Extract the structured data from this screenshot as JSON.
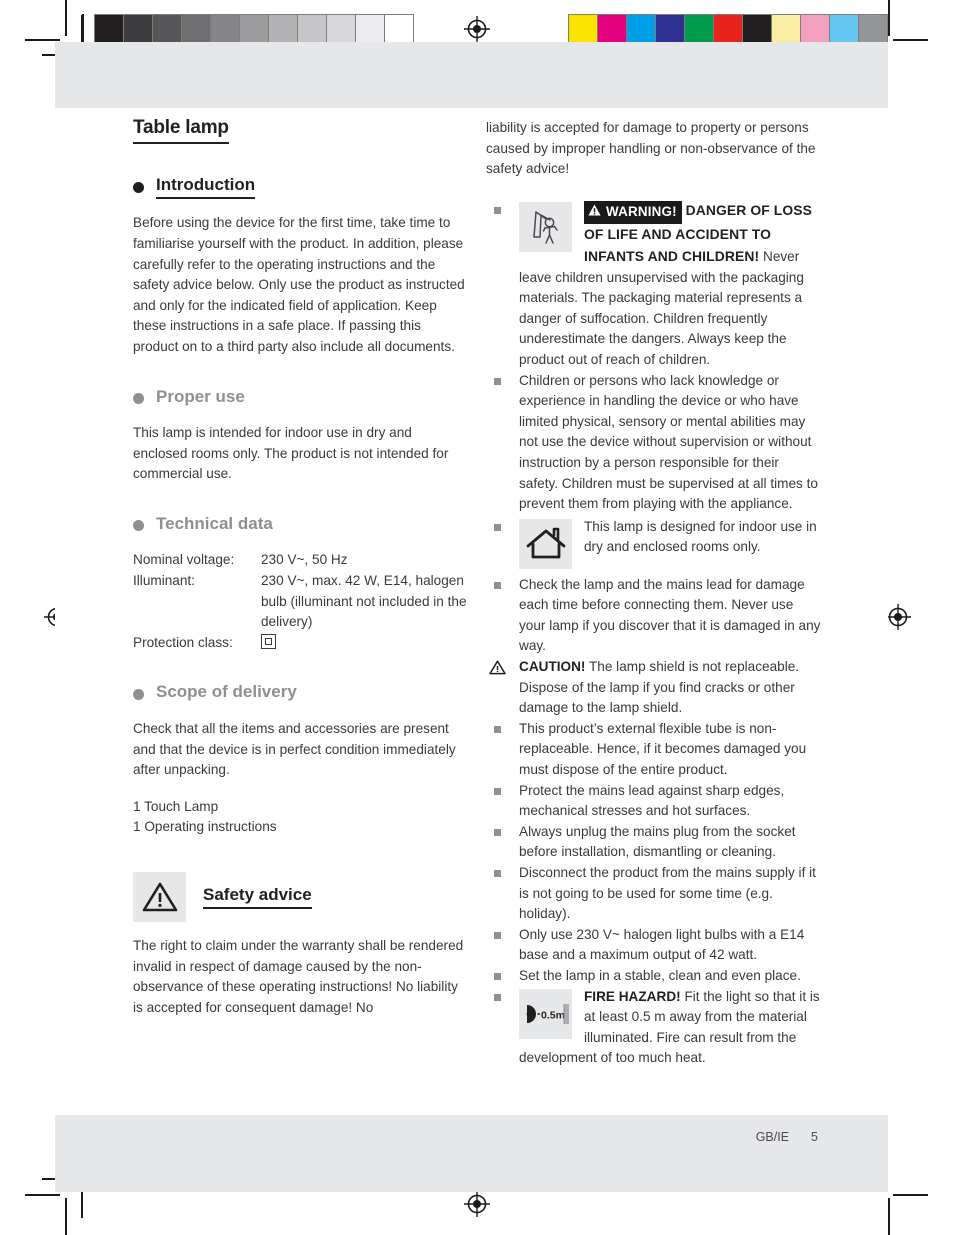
{
  "document": {
    "title": "Table lamp",
    "footer": {
      "locale": "GB/IE",
      "page": "5"
    }
  },
  "calibration": {
    "grayscale_bar": [
      "#231f20",
      "#3c3c3e",
      "#565658",
      "#6e6e70",
      "#868688",
      "#9c9c9e",
      "#b2b2b4",
      "#c6c6c8",
      "#d7d7d9",
      "#ececee",
      "#ffffff"
    ],
    "color_bar": [
      "#fbe500",
      "#e4007f",
      "#00a0e9",
      "#2e3192",
      "#009b4d",
      "#e8221d",
      "#231f20",
      "#faeca0",
      "#f4a0c0",
      "#63c7ef",
      "#939598"
    ]
  },
  "left_column": {
    "sections": [
      {
        "id": "introduction",
        "heading": "Introduction",
        "heading_style": "black",
        "paragraphs": [
          "Before using the device for the first time, take time to familiarise yourself with the product. In addition, please carefully refer to the operating instructions and the safety advice below. Only use the product as instructed and only for the indicated field of application. Keep these instructions in a safe place. If passing this product on to a third party also include all documents."
        ]
      },
      {
        "id": "proper-use",
        "heading": "Proper use",
        "heading_style": "grey",
        "paragraphs": [
          "This lamp is intended for indoor use in dry and enclosed rooms only. The product is not intended for commercial use."
        ]
      },
      {
        "id": "technical-data",
        "heading": "Technical data",
        "heading_style": "grey",
        "table": [
          {
            "key": "Nominal voltage:",
            "value": "230 V~, 50 Hz"
          },
          {
            "key": "Illuminant:",
            "value": "230 V~, max. 42 W, E14, halogen bulb (illuminant not included in the delivery)"
          },
          {
            "key": "Protection class:",
            "value": "",
            "icon": "protection-class-2-icon"
          }
        ]
      },
      {
        "id": "scope-of-delivery",
        "heading": "Scope of delivery",
        "heading_style": "grey",
        "paragraphs": [
          "Check that all the items and accessories are present and that the device is in perfect condition immediately after unpacking."
        ],
        "items": [
          "1 Touch Lamp",
          "1 Operating instructions"
        ]
      },
      {
        "id": "safety-advice",
        "heading": "Safety advice",
        "heading_style": "black-with-triangle",
        "icon": "warning-triangle-icon",
        "paragraphs": [
          "The right to claim under the warranty shall be rendered invalid in respect of damage caused by the non-observance of these operating instructions! No liability is accepted for consequent damage! No"
        ]
      }
    ]
  },
  "right_column": {
    "continuation": "liability is accepted for damage to property or persons caused by improper handling or non-observance of the safety advice!",
    "bullets": [
      {
        "id": "children-packaging",
        "marker": "square",
        "icon": "child-with-plastic-bag-icon",
        "warning_badge": "WARNING!",
        "warning_badge_icon": "warning-triangle-icon",
        "warning_heading": "DANGER OF LOSS OF LIFE AND ACCIDENT TO INFANTS AND CHILDREN!",
        "text": "Never leave children unsupervised with the packaging materials. The packaging material represents a danger of suffocation. Children frequently underestimate the dangers. Always keep the product out of reach of children."
      },
      {
        "id": "restricted-persons",
        "marker": "square",
        "text": "Children or persons who lack knowledge or experience in handling the device or who have limited physical, sensory or mental abilities may not use the device without supervision or without instruction by a person responsible for their safety. Children must be supervised at all times to prevent them from playing with the appliance."
      },
      {
        "id": "indoor-use",
        "marker": "square",
        "icon": "house-indoor-use-icon",
        "text": "This lamp is designed for indoor use in dry and enclosed rooms only."
      },
      {
        "id": "check-mains-lead",
        "marker": "square",
        "text": "Check the lamp and the mains lead for damage each time before connecting them. Never use your lamp if you discover that it is damaged in any way."
      },
      {
        "id": "lamp-shield",
        "marker": "triangle",
        "lead": "CAUTION!",
        "text": "The lamp shield is not replaceable. Dispose of the lamp if you find cracks or other damage to the lamp shield."
      },
      {
        "id": "flexible-tube",
        "marker": "square",
        "text": "This product’s external flexible tube is non-replaceable. Hence, if it becomes damaged you must dispose of the entire product."
      },
      {
        "id": "protect-mains-lead",
        "marker": "square",
        "text": "Protect the mains lead against sharp edges, mechanical stresses and hot surfaces."
      },
      {
        "id": "unplug",
        "marker": "square",
        "text": "Always unplug the mains plug from the socket before installation, dismantling or cleaning."
      },
      {
        "id": "disconnect",
        "marker": "square",
        "text": "Disconnect the product from the mains supply if it is not going to be used for some time (e.g. holiday)."
      },
      {
        "id": "bulb-spec",
        "marker": "square",
        "text": "Only use 230 V~ halogen light bulbs with a E14 base and a maximum output of 42 watt."
      },
      {
        "id": "stable-place",
        "marker": "square",
        "text": "Set the lamp in a stable, clean and even place."
      },
      {
        "id": "fire-hazard",
        "marker": "square",
        "icon": "distance-0-5m-icon",
        "icon_label": "0.5m",
        "lead": "FIRE HAZARD!",
        "text": "Fit the light so that it is at least 0.5 m away from the material illuminated. Fire can result from the development of too much heat."
      }
    ]
  }
}
